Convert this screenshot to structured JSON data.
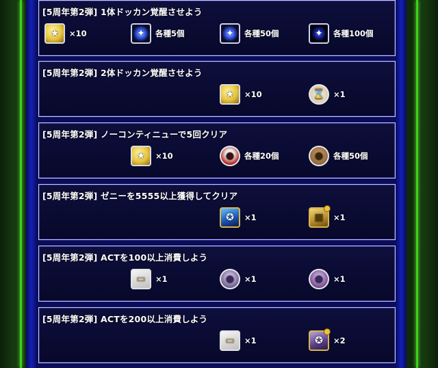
{
  "missions": [
    {
      "title": "[5周年第2弾] 1体ドッカン覚醒させよう",
      "rewards": [
        {
          "icon": "medal-icon",
          "glyph": "★",
          "qty": "×10"
        },
        {
          "icon": "dragon-stone-orb-icon",
          "glyph": "✦",
          "qty": "各種5個"
        },
        {
          "icon": "dragon-stone-orb-icon",
          "glyph": "✦",
          "qty": "各種50個"
        },
        {
          "icon": "dark-orb-icon",
          "glyph": "✦",
          "qty": "各種100個"
        }
      ]
    },
    {
      "title": "[5周年第2弾] 2体ドッカン覚醒させよう",
      "rewards": [
        {
          "icon": "medal-icon",
          "glyph": "★",
          "qty": "×10"
        },
        {
          "icon": "hourglass-icon",
          "glyph": "⌛",
          "qty": "×1"
        }
      ]
    },
    {
      "title": "[5周年第2弾] ノーコンティニューで5回クリア",
      "rewards": [
        {
          "icon": "medal-icon",
          "glyph": "★",
          "qty": "×10"
        },
        {
          "icon": "red-training-item-icon",
          "glyph": "●",
          "qty": "各種20個"
        },
        {
          "icon": "brown-training-item-icon",
          "glyph": "●",
          "qty": "各種50個"
        }
      ]
    },
    {
      "title": "[5周年第2弾] ゼニーを5555以上獲得してクリア",
      "rewards": [
        {
          "icon": "character-card-icon",
          "glyph": "✪",
          "qty": "×1"
        },
        {
          "icon": "gold-card-icon",
          "glyph": "▦",
          "qty": "×1"
        }
      ]
    },
    {
      "title": "[5周年第2弾] ACTを100以上消費しよう",
      "rewards": [
        {
          "icon": "ticket-icon",
          "glyph": "▭",
          "qty": "×1"
        },
        {
          "icon": "support-item-icon",
          "glyph": "●",
          "qty": "×1"
        },
        {
          "icon": "support-item-icon",
          "glyph": "●",
          "qty": "×1"
        }
      ]
    },
    {
      "title": "[5周年第2弾] ACTを200以上消費しよう",
      "rewards": [
        {
          "icon": "ticket-icon",
          "glyph": "▭",
          "qty": "×1"
        },
        {
          "icon": "character-card-icon",
          "glyph": "✪",
          "qty": "×2"
        }
      ]
    }
  ]
}
